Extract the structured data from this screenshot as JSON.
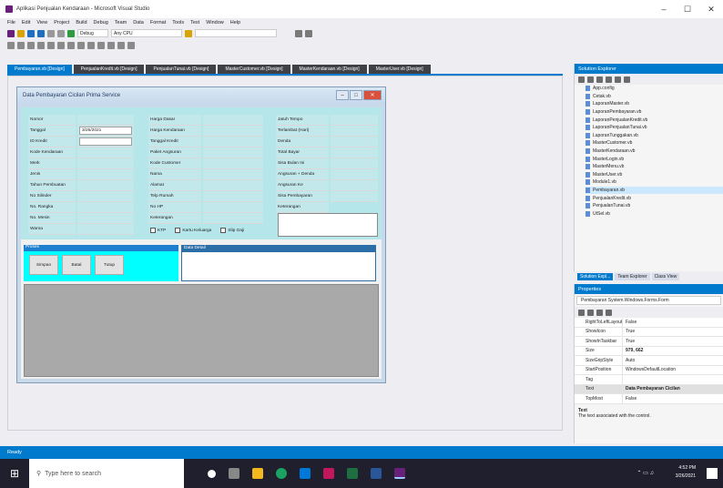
{
  "window": {
    "title": "Aplikasi Penjualan Kendaraan - Microsoft Visual Studio",
    "min": "–",
    "max": "☐",
    "close": "✕"
  },
  "menu": [
    "File",
    "Edit",
    "View",
    "Project",
    "Build",
    "Debug",
    "Team",
    "Data",
    "Format",
    "Tools",
    "Test",
    "Window",
    "Help"
  ],
  "toolbar": {
    "config": "Debug",
    "platform": "Any CPU"
  },
  "tabs": [
    "Pembayaran.vb [Design]",
    "PenjualanKredit.vb [Design]",
    "PenjualanTunai.vb [Design]",
    "MasterCustomer.vb [Design]",
    "MasterKendaraan.vb [Design]",
    "MasterUser.vb [Design]"
  ],
  "form": {
    "title": "Data Pembayaran Cicilan Prima Service",
    "col1": [
      "Nomor",
      "Tanggal",
      "ID Kredit",
      "Kode Kendaraan",
      "Merk",
      "Jenis",
      "Tahun Pembuatan",
      "No Silinder",
      "No. Rangka",
      "No. Mesin",
      "Warna"
    ],
    "date": "3/25/2021",
    "col2": [
      "Harga Dasar",
      "Harga Kendaraan",
      "Tanggal Kredit",
      "Paket Angsuran",
      "Kode Customer",
      "Nama",
      "Alamat",
      "Telp Rumah",
      "No HP",
      "Keterangan"
    ],
    "col3": [
      "Jatuh Tempo",
      "Terlambat (Hari)",
      "Denda",
      "Total Bayar",
      "Sisa Bulan Ini",
      "Angsuran + Denda",
      "Angsuran Ke",
      "Sisa Pembayaran",
      "Keterangan"
    ],
    "checks": [
      "KTP",
      "Kartu Keluarga",
      "Slip Gaji"
    ],
    "proses_label": "Proses",
    "buttons": [
      "Simpan",
      "Batal",
      "Tutup"
    ],
    "data_label": "Data Detail"
  },
  "solution_explorer": {
    "title": "Solution Explorer",
    "items": [
      "App.config",
      "Cetak.vb",
      "LaporanMaster.vb",
      "LaporanPembayaran.vb",
      "LaporanPenjualanKredit.vb",
      "LaporanPenjualanTunai.vb",
      "LaporanTunggakan.vb",
      "MasterCustomer.vb",
      "MasterKendaraan.vb",
      "MasterLogin.vb",
      "MasterMenu.vb",
      "MasterUser.vb",
      "Module1.vb",
      "Pembayaran.vb",
      "PenjualanKredit.vb",
      "PenjualanTunai.vb",
      "UtSel.vb"
    ],
    "selected_index": 13
  },
  "pane_tabs": [
    "Solution Expl...",
    "Team Explorer",
    "Class View"
  ],
  "properties": {
    "title": "Properties",
    "object": "Pembayaran System.Windows.Forms.Form",
    "rows": [
      [
        "RightToLeftLayout",
        "False"
      ],
      [
        "ShowIcon",
        "True"
      ],
      [
        "ShowInTaskbar",
        "True"
      ],
      [
        "Size",
        "979, 662"
      ],
      [
        "SizeGripStyle",
        "Auto"
      ],
      [
        "StartPosition",
        "WindowsDefaultLocation"
      ],
      [
        "Tag",
        ""
      ],
      [
        "Text",
        "Data Pembayaran Cicilan"
      ],
      [
        "TopMost",
        "False"
      ]
    ],
    "desc_title": "Text",
    "desc": "The text associated with the control."
  },
  "status": "Ready",
  "taskbar": {
    "search_placeholder": "Type here to search",
    "time": "4:52 PM",
    "date": "3/26/2021"
  },
  "colors": {
    "accent": "#007acc",
    "form_bg": "#b4e6ea",
    "proses_bg": "#00ffff"
  }
}
